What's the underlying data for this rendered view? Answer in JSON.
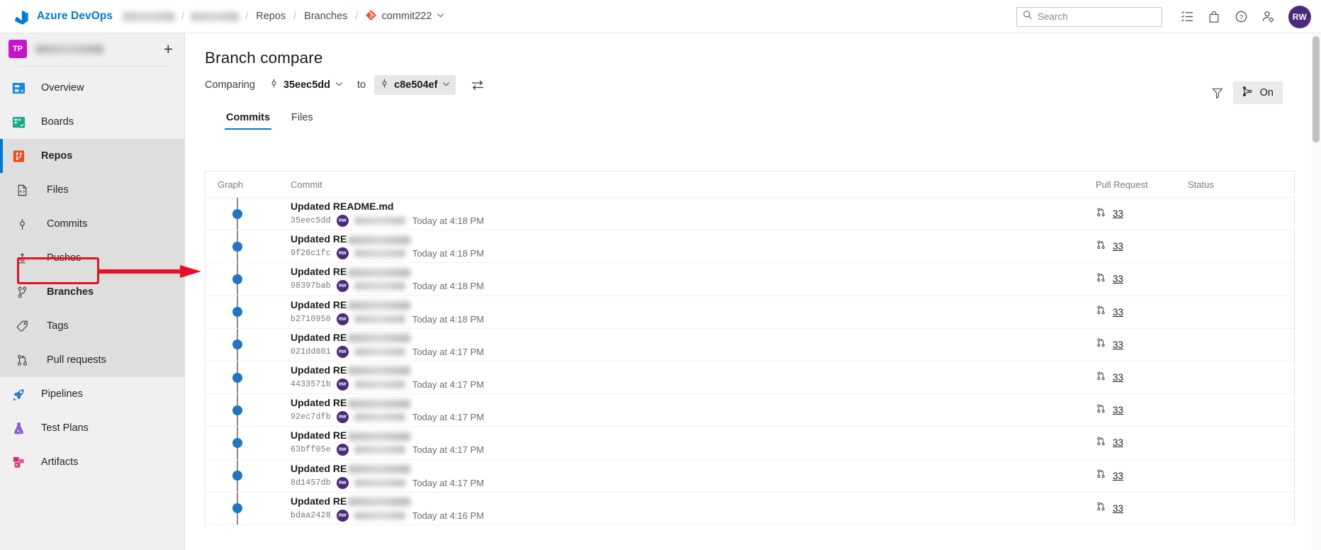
{
  "topbar": {
    "brand": "Azure DevOps",
    "logo_icon": "azure-devops-logo-icon",
    "breadcrumb": {
      "org_blurred": "",
      "project_blurred": "",
      "repos": "Repos",
      "branches": "Branches",
      "repo_name": "commit222",
      "repo_icon": "git-repository-icon",
      "chevron_icon": "chevron-down-icon"
    },
    "search": {
      "placeholder": "Search",
      "icon": "search-icon",
      "value": ""
    },
    "icons": [
      {
        "name": "work-items-icon",
        "glyph": "list"
      },
      {
        "name": "marketplace-bag-icon",
        "glyph": "bag"
      },
      {
        "name": "help-question-icon",
        "glyph": "question"
      },
      {
        "name": "user-settings-icon",
        "glyph": "person-gear"
      }
    ],
    "avatar": {
      "initials": "RW",
      "color": "#4b2a7b"
    }
  },
  "sidebar": {
    "project": {
      "initials": "TP",
      "name_blurred": "",
      "avatar_color": "#c716c7"
    },
    "add_button_label": "+",
    "items": [
      {
        "label": "Overview",
        "icon": "overview-icon"
      },
      {
        "label": "Boards",
        "icon": "boards-icon"
      },
      {
        "label": "Repos",
        "icon": "repos-icon"
      },
      {
        "label": "Files",
        "icon": "files-icon"
      },
      {
        "label": "Commits",
        "icon": "commits-icon"
      },
      {
        "label": "Pushes",
        "icon": "pushes-icon"
      },
      {
        "label": "Branches",
        "icon": "branches-icon"
      },
      {
        "label": "Tags",
        "icon": "tags-icon"
      },
      {
        "label": "Pull requests",
        "icon": "pull-requests-icon"
      },
      {
        "label": "Pipelines",
        "icon": "pipelines-icon"
      },
      {
        "label": "Test Plans",
        "icon": "test-plans-icon"
      },
      {
        "label": "Artifacts",
        "icon": "artifacts-icon"
      }
    ]
  },
  "annotation": {
    "color": "#e81123",
    "target": "Branches",
    "arrow_icon": "right-arrow-annotation-icon"
  },
  "page": {
    "title": "Branch compare",
    "comparing_label": "Comparing",
    "source_ref": "35eec5dd",
    "to_label": "to",
    "target_ref": "c8e504ef",
    "ref_icon": "commit-icon",
    "chevron_icon": "chevron-down-icon",
    "swap_icon": "swap-arrows-icon",
    "filter_icon": "filter-funnel-icon",
    "graph_toggle": {
      "label": "On",
      "icon": "branch-graph-icon"
    },
    "tabs": [
      {
        "label": "Commits",
        "active": true
      },
      {
        "label": "Files",
        "active": false
      }
    ]
  },
  "table": {
    "columns": [
      "Graph",
      "Commit",
      "Pull Request",
      "Status"
    ],
    "rows": [
      {
        "title": "Updated README.md",
        "title_blurred": false,
        "hash": "35eec5dd",
        "author_initials": "RW",
        "time": "Today at 4:18 PM",
        "pr": "33",
        "status": ""
      },
      {
        "title": "Updated RE",
        "title_blurred": true,
        "hash": "9f26c1fc",
        "author_initials": "RW",
        "time": "Today at 4:18 PM",
        "pr": "33",
        "status": ""
      },
      {
        "title": "Updated RE",
        "title_blurred": true,
        "hash": "98397bab",
        "author_initials": "RW",
        "time": "Today at 4:18 PM",
        "pr": "33",
        "status": ""
      },
      {
        "title": "Updated RE",
        "title_blurred": true,
        "hash": "b2710950",
        "author_initials": "RW",
        "time": "Today at 4:18 PM",
        "pr": "33",
        "status": ""
      },
      {
        "title": "Updated RE",
        "title_blurred": true,
        "hash": "021dd881",
        "author_initials": "RW",
        "time": "Today at 4:17 PM",
        "pr": "33",
        "status": ""
      },
      {
        "title": "Updated RE",
        "title_blurred": true,
        "hash": "4433571b",
        "author_initials": "RW",
        "time": "Today at 4:17 PM",
        "pr": "33",
        "status": ""
      },
      {
        "title": "Updated RE",
        "title_blurred": true,
        "hash": "92ec7dfb",
        "author_initials": "RW",
        "time": "Today at 4:17 PM",
        "pr": "33",
        "status": ""
      },
      {
        "title": "Updated RE",
        "title_blurred": true,
        "hash": "63bff05e",
        "author_initials": "RW",
        "time": "Today at 4:17 PM",
        "pr": "33",
        "status": ""
      },
      {
        "title": "Updated RE",
        "title_blurred": true,
        "hash": "8d1457db",
        "author_initials": "RW",
        "time": "Today at 4:17 PM",
        "pr": "33",
        "status": ""
      },
      {
        "title": "Updated RE",
        "title_blurred": true,
        "hash": "bdaa2428",
        "author_initials": "RW",
        "time": "Today at 4:16 PM",
        "pr": "33",
        "status": ""
      }
    ]
  },
  "colors": {
    "accent": "#0078d4",
    "graph_dot": "#1f77c4",
    "annotation": "#e81123"
  }
}
